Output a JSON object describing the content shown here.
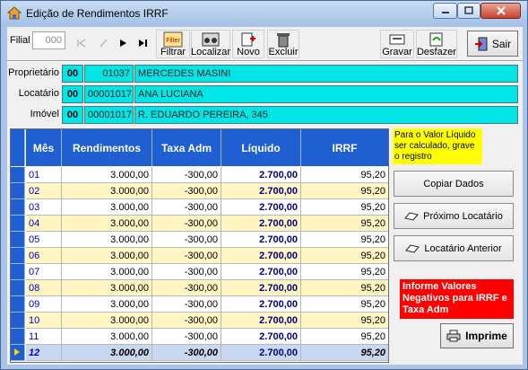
{
  "window": {
    "title": "Edição de Rendimentos IRRF"
  },
  "toolbar": {
    "filial_label": "Filial",
    "filial_value": "000",
    "filtrar": "Filtrar",
    "localizar": "Localizar",
    "novo": "Novo",
    "excluir": "Excluir",
    "gravar": "Gravar",
    "desfazer": "Desfazer",
    "sair": "Sair"
  },
  "fields": {
    "proprietario": {
      "label": "Proprietário",
      "code": "00",
      "id": "01037",
      "name": "MERCEDES MASINI"
    },
    "locatario": {
      "label": "Locatário",
      "code": "00",
      "id": "00001017",
      "name": "ANA LUCIANA"
    },
    "imovel": {
      "label": "Imóvel",
      "code": "00",
      "id": "00001017",
      "name": "R. EDUARDO PEREIRA, 345"
    }
  },
  "grid": {
    "columns": [
      "Mês",
      "Rendimentos",
      "Taxa Adm",
      "Líquido",
      "IRRF"
    ],
    "rows": [
      {
        "mes": "01",
        "rendimentos": "3.000,00",
        "taxa": "-300,00",
        "liquido": "2.700,00",
        "irrf": "95,20"
      },
      {
        "mes": "02",
        "rendimentos": "3.000,00",
        "taxa": "-300,00",
        "liquido": "2.700,00",
        "irrf": "95,20"
      },
      {
        "mes": "03",
        "rendimentos": "3.000,00",
        "taxa": "-300,00",
        "liquido": "2.700,00",
        "irrf": "95,20"
      },
      {
        "mes": "04",
        "rendimentos": "3.000,00",
        "taxa": "-300,00",
        "liquido": "2.700,00",
        "irrf": "95,20"
      },
      {
        "mes": "05",
        "rendimentos": "3.000,00",
        "taxa": "-300,00",
        "liquido": "2.700,00",
        "irrf": "95,20"
      },
      {
        "mes": "06",
        "rendimentos": "3.000,00",
        "taxa": "-300,00",
        "liquido": "2.700,00",
        "irrf": "95,20"
      },
      {
        "mes": "07",
        "rendimentos": "3.000,00",
        "taxa": "-300,00",
        "liquido": "2.700,00",
        "irrf": "95,20"
      },
      {
        "mes": "08",
        "rendimentos": "3.000,00",
        "taxa": "-300,00",
        "liquido": "2.700,00",
        "irrf": "95,20"
      },
      {
        "mes": "09",
        "rendimentos": "3.000,00",
        "taxa": "-300,00",
        "liquido": "2.700,00",
        "irrf": "95,20"
      },
      {
        "mes": "10",
        "rendimentos": "3.000,00",
        "taxa": "-300,00",
        "liquido": "2.700,00",
        "irrf": "95,20"
      },
      {
        "mes": "11",
        "rendimentos": "3.000,00",
        "taxa": "-300,00",
        "liquido": "2.700,00",
        "irrf": "95,20"
      },
      {
        "mes": "12",
        "rendimentos": "3.000,00",
        "taxa": "-300,00",
        "liquido": "2.700,00",
        "irrf": "95,20"
      }
    ],
    "selected_row": "12"
  },
  "side": {
    "note": "Para o Valor Líquido ser calculado, grave o registro",
    "copiar": "Copiar Dados",
    "proximo": "Próximo Locatário",
    "anterior": "Locatário Anterior",
    "warning": "Informe Valores Negativos para IRRF e Taxa Adm",
    "imprime": "Imprime"
  },
  "colors": {
    "grid_header": "#1f5fd2",
    "field_bg": "#00e6e6",
    "alt_row": "#fff6c4",
    "warning_bg": "#ff0000",
    "note_bg": "#ffff00"
  }
}
